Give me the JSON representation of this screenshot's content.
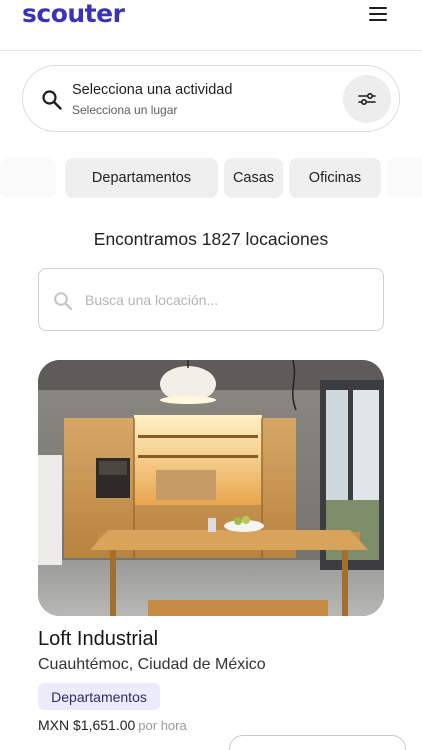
{
  "header": {
    "logo": "scouter",
    "menu_icon": "hamburger-menu-icon"
  },
  "search": {
    "activity_label": "Selecciona una actividad",
    "place_label": "Selecciona un lugar",
    "search_icon": "search-icon",
    "filter_icon": "sliders-icon"
  },
  "categories": [
    {
      "label": "Departamentos"
    },
    {
      "label": "Casas"
    },
    {
      "label": "Oficinas"
    }
  ],
  "results": {
    "text": "Encontramos 1827 locaciones"
  },
  "location_search": {
    "placeholder": "Busca una locación...",
    "value": ""
  },
  "listing": {
    "title": "Loft Industrial",
    "location": "Cuauhtémoc, Ciudad de México",
    "tag": "Departamentos",
    "price": "MXN $1,651.00",
    "price_unit": "por hora"
  },
  "colors": {
    "brand": "#3b32b8",
    "tag_bg": "#ecebfa",
    "chip_bg": "#efefef"
  }
}
